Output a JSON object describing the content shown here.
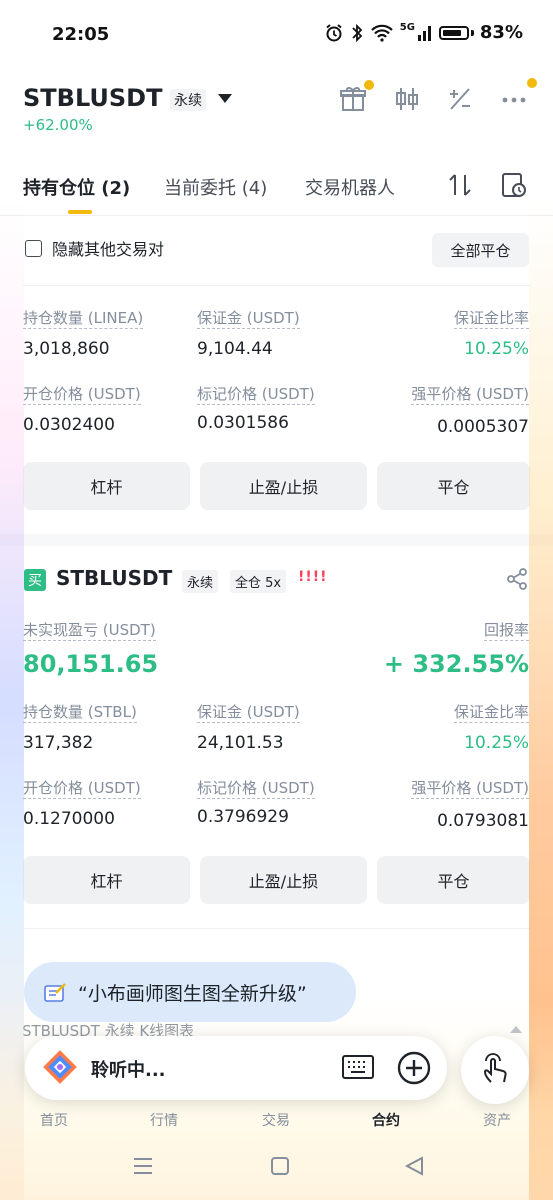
{
  "status_bar": {
    "time": "22:05",
    "network": "5G",
    "battery": "83%"
  },
  "header": {
    "symbol": "STBLUSDT",
    "contract_type": "永续",
    "change": "+62.00%"
  },
  "tabs": [
    {
      "label": "持有仓位 (2)",
      "active": true
    },
    {
      "label": "当前委托 (4)",
      "active": false
    },
    {
      "label": "交易机器人",
      "active": false
    }
  ],
  "filter": {
    "hide_other_pairs": "隐藏其他交易对",
    "close_all": "全部平仓"
  },
  "position1": {
    "qty_label": "持仓数量 (LINEA)",
    "qty": "3,018,860",
    "margin_label": "保证金 (USDT)",
    "margin": "9,104.44",
    "margin_ratio_label": "保证金比率",
    "margin_ratio": "10.25%",
    "entry_label": "开仓价格 (USDT)",
    "entry": "0.0302400",
    "mark_label": "标记价格 (USDT)",
    "mark": "0.0301586",
    "liq_label": "强平价格 (USDT)",
    "liq": "0.0005307",
    "buttons": [
      "杠杆",
      "止盈/止损",
      "平仓"
    ]
  },
  "position2": {
    "side_badge": "买",
    "symbol": "STBLUSDT",
    "contract_type": "永续",
    "margin_mode": "全仓 5x",
    "warning": "!!!!",
    "pnl_label": "未实现盈亏 (USDT)",
    "pnl": "80,151.65",
    "roe_label": "回报率",
    "roe": "+ 332.55%",
    "qty_label": "持仓数量 (STBL)",
    "qty": "317,382",
    "margin_label": "保证金 (USDT)",
    "margin": "24,101.53",
    "margin_ratio_label": "保证金比率",
    "margin_ratio": "10.25%",
    "entry_label": "开仓价格 (USDT)",
    "entry": "0.1270000",
    "mark_label": "标记价格 (USDT)",
    "mark": "0.3796929",
    "liq_label": "强平价格 (USDT)",
    "liq": "0.0793081",
    "buttons": [
      "杠杆",
      "止盈/止损",
      "平仓"
    ]
  },
  "assistant": {
    "banner": "“小布画师图生图全新升级”",
    "chart_strip": "STBLUSDT 永续 K线图表",
    "listening": "聆听中..."
  },
  "bottom_nav": [
    {
      "label": "首页",
      "active": false
    },
    {
      "label": "行情",
      "active": false
    },
    {
      "label": "交易",
      "active": false
    },
    {
      "label": "合约",
      "active": true
    },
    {
      "label": "资产",
      "active": false
    }
  ],
  "colors": {
    "accent": "#f0b90b",
    "profit": "#2ebd85",
    "warning": "#f6465d"
  }
}
